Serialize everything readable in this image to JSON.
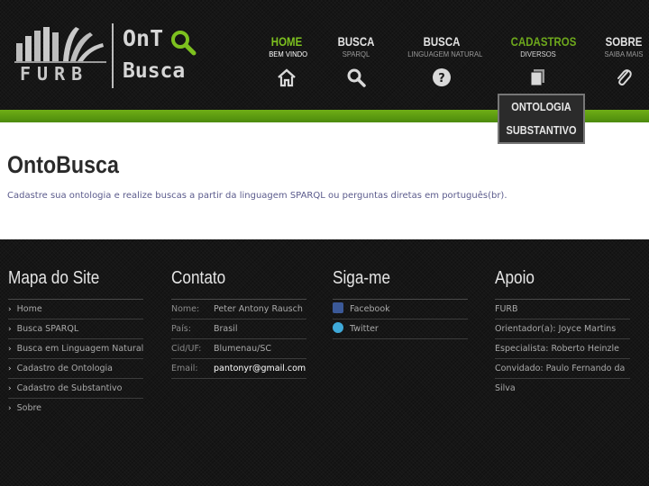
{
  "logo": {
    "furb": "FURB",
    "onto": "OnT",
    "busca": "Busca"
  },
  "nav": [
    {
      "title": "HOME",
      "subtitle": "BEM VINDO",
      "icon": "house-icon",
      "state": "active"
    },
    {
      "title": "BUSCA",
      "subtitle": "SPARQL",
      "icon": "search-icon",
      "state": "normal"
    },
    {
      "title": "BUSCA",
      "subtitle": "LINGUAGEM NATURAL",
      "icon": "question-icon",
      "state": "normal"
    },
    {
      "title": "CADASTROS",
      "subtitle": "DIVERSOS",
      "icon": "documents-icon",
      "state": "highlight"
    },
    {
      "title": "SOBRE",
      "subtitle": "SAIBA MAIS",
      "icon": "paperclip-icon",
      "state": "normal"
    }
  ],
  "dropdown": [
    "ONTOLOGIA",
    "SUBSTANTIVO"
  ],
  "main": {
    "title": "OntoBusca",
    "description": "Cadastre sua ontologia e realize buscas a partir da linguagem SPARQL ou perguntas diretas em português(br)."
  },
  "footer": {
    "sitemap": {
      "title": "Mapa do Site",
      "items": [
        "Home",
        "Busca SPARQL",
        "Busca em Linguagem Natural",
        "Cadastro de Ontologia",
        "Cadastro de Substantivo",
        "Sobre"
      ]
    },
    "contact": {
      "title": "Contato",
      "rows": [
        {
          "key": "Nome:",
          "value": "Peter Antony Rausch"
        },
        {
          "key": "País:",
          "value": "Brasil"
        },
        {
          "key": "Cid/UF:",
          "value": "Blumenau/SC"
        },
        {
          "key": "Email:",
          "value": "pantonyr@gmail.com"
        }
      ]
    },
    "social": {
      "title": "Siga-me",
      "items": [
        {
          "label": "Facebook",
          "icon": "facebook-icon"
        },
        {
          "label": "Twitter",
          "icon": "twitter-icon"
        }
      ]
    },
    "support": {
      "title": "Apoio",
      "link": "FURB",
      "rows": [
        "Orientador(a): Joyce Martins",
        "Especialista: Roberto Heinzle",
        "Convidado: Paulo Fernando da",
        "Silva"
      ]
    }
  },
  "colors": {
    "accent_green": "#6fae16",
    "active_nav": "#7dc11f",
    "background": "#161616"
  }
}
